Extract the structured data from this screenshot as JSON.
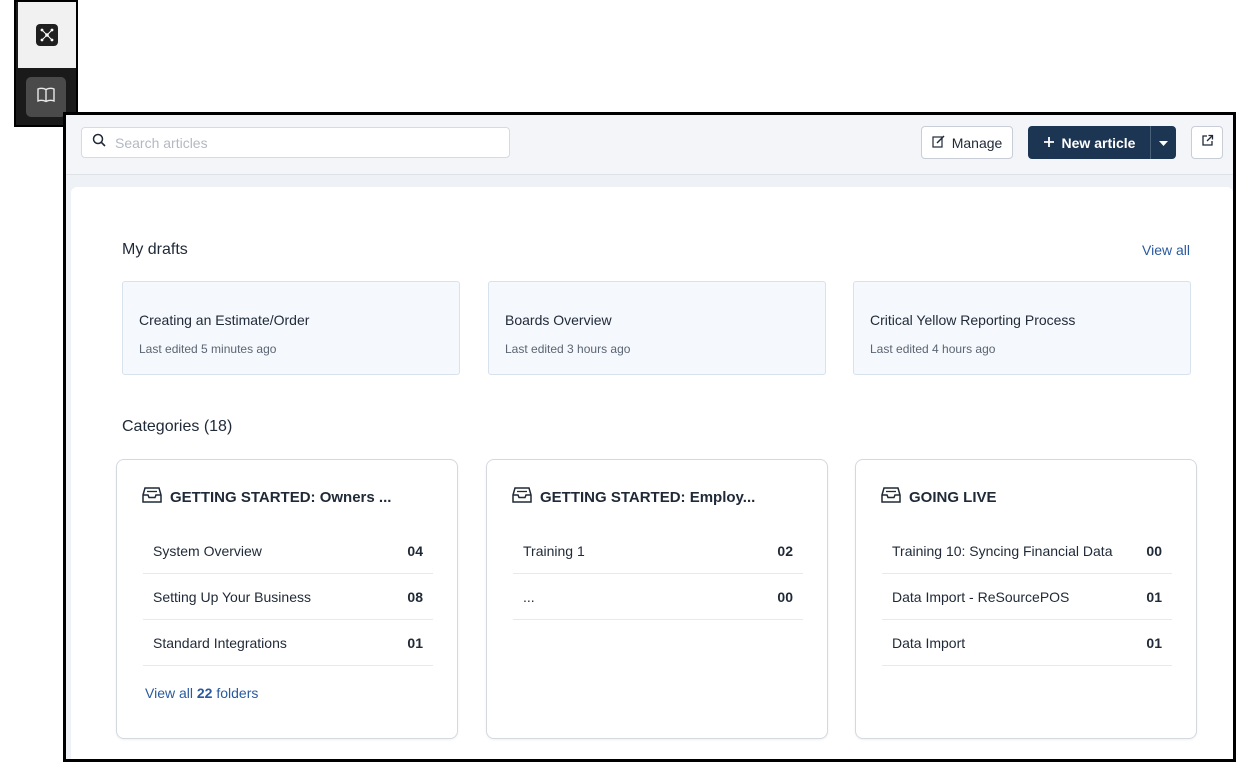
{
  "rail": {
    "top_icon": "network-graph-icon",
    "bottom_icon": "open-book-icon"
  },
  "topbar": {
    "search_placeholder": "Search articles",
    "manage_label": "Manage",
    "new_article_label": "New article"
  },
  "drafts": {
    "title": "My drafts",
    "view_all": "View all",
    "items": [
      {
        "title": "Creating an Estimate/Order",
        "edited": "Last edited 5 minutes ago"
      },
      {
        "title": "Boards Overview",
        "edited": "Last edited 3 hours ago"
      },
      {
        "title": "Critical Yellow Reporting Process",
        "edited": "Last edited 4 hours ago"
      }
    ]
  },
  "categories": {
    "title": "Categories (18)",
    "items": [
      {
        "name": "GETTING STARTED: Owners ...",
        "rows": [
          {
            "label": "System Overview",
            "count": "04"
          },
          {
            "label": "Setting Up Your Business",
            "count": "08"
          },
          {
            "label": "Standard Integrations",
            "count": "01"
          }
        ],
        "footer_prefix": "View all",
        "footer_count": "22",
        "footer_suffix": "folders"
      },
      {
        "name": "GETTING STARTED: Employ...",
        "rows": [
          {
            "label": "Training 1",
            "count": "02"
          },
          {
            "label": "...",
            "count": "00"
          }
        ]
      },
      {
        "name": "GOING LIVE",
        "rows": [
          {
            "label": "Training 10: Syncing Financial Data",
            "count": "00"
          },
          {
            "label": "Data Import - ReSourcePOS",
            "count": "01"
          },
          {
            "label": "Data Import",
            "count": "01"
          }
        ]
      }
    ]
  },
  "colors": {
    "primary": "#1c3552",
    "link": "#2a5a9e",
    "draft_bg": "#f5f8fc"
  }
}
